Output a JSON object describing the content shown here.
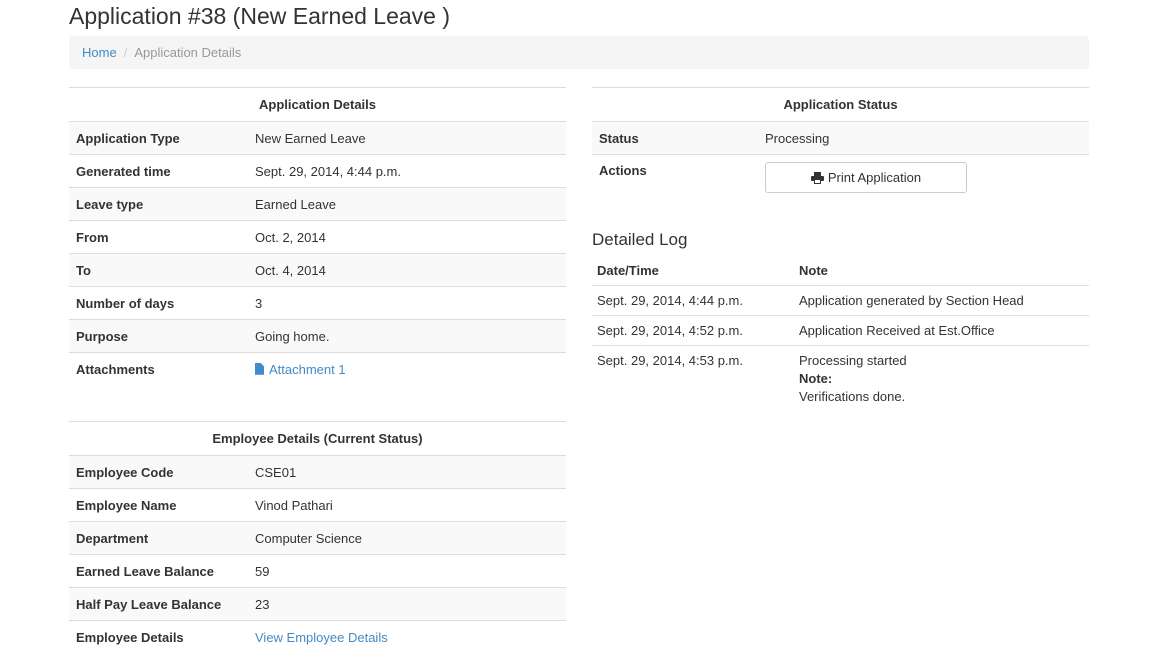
{
  "page": {
    "title": "Application #38 (New Earned Leave )"
  },
  "breadcrumb": {
    "home": "Home",
    "separator": "/",
    "current": "Application Details"
  },
  "application_details": {
    "heading": "Application Details",
    "rows": [
      {
        "label": "Application Type",
        "value": "New Earned Leave"
      },
      {
        "label": "Generated time",
        "value": "Sept. 29, 2014, 4:44 p.m."
      },
      {
        "label": "Leave type",
        "value": "Earned Leave"
      },
      {
        "label": "From",
        "value": "Oct. 2, 2014"
      },
      {
        "label": "To",
        "value": "Oct. 4, 2014"
      },
      {
        "label": "Number of days",
        "value": "3"
      },
      {
        "label": "Purpose",
        "value": "Going home."
      },
      {
        "label": "Attachments",
        "value": "Attachment 1",
        "icon": "file-icon"
      }
    ]
  },
  "employee_details": {
    "heading": "Employee Details (Current Status)",
    "rows": [
      {
        "label": "Employee Code",
        "value": "CSE01"
      },
      {
        "label": "Employee Name",
        "value": "Vinod Pathari"
      },
      {
        "label": "Department",
        "value": "Computer Science"
      },
      {
        "label": "Earned Leave Balance",
        "value": "59"
      },
      {
        "label": "Half Pay Leave Balance",
        "value": "23"
      },
      {
        "label": "Employee Details",
        "value": "View Employee Details"
      }
    ]
  },
  "application_status": {
    "heading": "Application Status",
    "status_label": "Status",
    "status_value": "Processing",
    "actions_label": "Actions",
    "print_button": "Print Application",
    "print_icon": "print-icon"
  },
  "detailed_log": {
    "title": "Detailed Log",
    "columns": [
      "Date/Time",
      "Note"
    ],
    "rows": [
      {
        "datetime": "Sept. 29, 2014, 4:44 p.m.",
        "note": "Application generated by Section Head"
      },
      {
        "datetime": "Sept. 29, 2014, 4:52 p.m.",
        "note": "Application Received at Est.Office"
      },
      {
        "datetime": "Sept. 29, 2014, 4:53 p.m.",
        "note": "Processing started",
        "extra_label": "Note:",
        "extra_text": "Verifications done."
      }
    ]
  },
  "colors": {
    "link": "#428bca",
    "border": "#dddddd",
    "stripe": "#f9f9f9",
    "breadcrumb_bg": "#f5f5f5"
  }
}
